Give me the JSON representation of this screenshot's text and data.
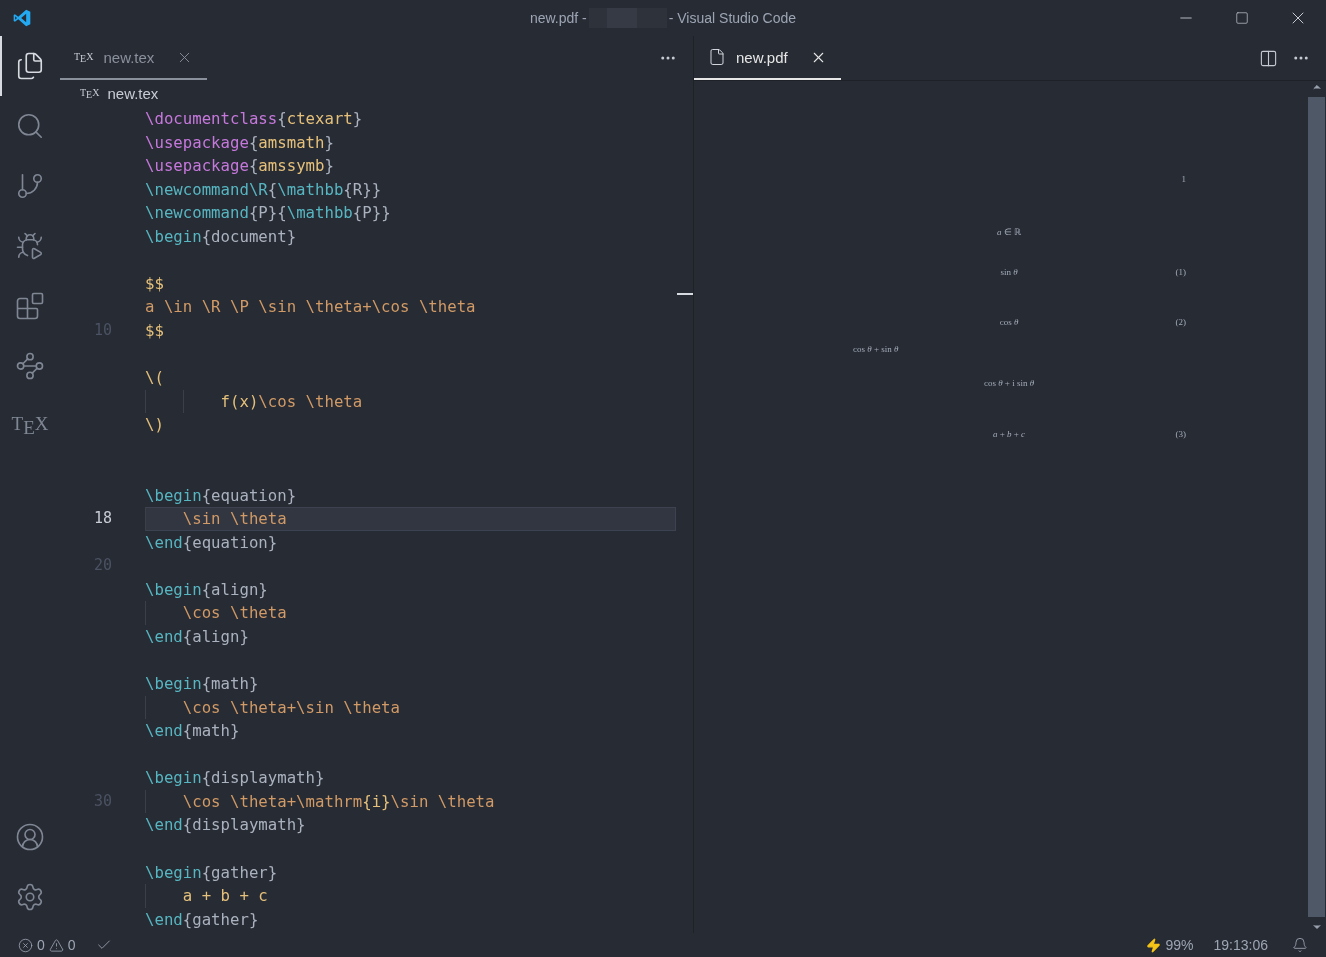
{
  "title_bar": {
    "title_start": "new.pdf -",
    "title_end": "- Visual Studio Code"
  },
  "activity_bar": {
    "top": [
      {
        "kind": "files",
        "selected": true
      },
      {
        "kind": "search",
        "selected": false
      },
      {
        "kind": "source-control",
        "selected": false
      },
      {
        "kind": "run-debug",
        "selected": false
      },
      {
        "kind": "extensions",
        "selected": false
      },
      {
        "kind": "remote",
        "selected": false
      },
      {
        "kind": "tex",
        "label": "T$_{E}$X",
        "selected": false
      }
    ],
    "bottom": [
      {
        "kind": "account"
      },
      {
        "kind": "settings"
      }
    ]
  },
  "editor": {
    "tab": {
      "icon_text": "T$_{E}$X",
      "label": "new.tex",
      "selected": true
    },
    "breadcrumb": {
      "icon_text": "T$_{E}$X",
      "label": "new.tex"
    },
    "lines": [
      {
        "current": false,
        "tokens": [
          {
            "kind": "keyword",
            "t": "\\documentclass"
          },
          {
            "kind": "brace",
            "t": "{"
          },
          {
            "kind": "arg",
            "t": "ctexart"
          },
          {
            "kind": "brace",
            "t": "}"
          }
        ]
      },
      {
        "current": false,
        "tokens": [
          {
            "kind": "keyword",
            "t": "\\usepackage"
          },
          {
            "kind": "brace",
            "t": "{"
          },
          {
            "kind": "arg",
            "t": "amsmath"
          },
          {
            "kind": "brace",
            "t": "}"
          }
        ]
      },
      {
        "current": false,
        "tokens": [
          {
            "kind": "keyword",
            "t": "\\usepackage"
          },
          {
            "kind": "brace",
            "t": "{"
          },
          {
            "kind": "arg",
            "t": "amssymb"
          },
          {
            "kind": "brace",
            "t": "}"
          }
        ]
      },
      {
        "current": false,
        "tokens": [
          {
            "kind": "command",
            "t": "\\newcommand\\R"
          },
          {
            "kind": "brace",
            "t": "{"
          },
          {
            "kind": "command",
            "t": "\\mathbb"
          },
          {
            "kind": "text",
            "t": "{R}}"
          }
        ]
      },
      {
        "current": false,
        "tokens": [
          {
            "kind": "command",
            "t": "\\newcommand"
          },
          {
            "kind": "text",
            "t": "{P}{"
          },
          {
            "kind": "command",
            "t": "\\mathbb"
          },
          {
            "kind": "text",
            "t": "{P}}"
          }
        ]
      },
      {
        "current": false,
        "tokens": [
          {
            "kind": "command",
            "t": "\\begin"
          },
          {
            "kind": "text",
            "t": "{document}"
          }
        ]
      },
      {
        "current": false
      },
      {
        "current": false,
        "tokens": [
          {
            "kind": "mathsym",
            "t": "$$"
          }
        ]
      },
      {
        "current": false,
        "tokens": [
          {
            "kind": "math",
            "t": "a \\in \\R \\P \\sin \\theta+\\cos \\theta"
          }
        ]
      },
      {
        "current": false,
        "number": "10",
        "tokens": [
          {
            "kind": "mathsym",
            "t": "$$"
          }
        ]
      },
      {
        "current": false
      },
      {
        "current": false,
        "tokens": [
          {
            "kind": "mathsym",
            "t": "\\("
          }
        ]
      },
      {
        "current": false,
        "tokens": [
          {
            "kind": "mathsym",
            "t": "        f(x)"
          },
          {
            "kind": "math",
            "t": "\\cos \\theta"
          }
        ]
      },
      {
        "current": false,
        "tokens": [
          {
            "kind": "mathsym",
            "t": "\\)"
          }
        ]
      },
      {
        "current": false
      },
      {
        "current": false
      },
      {
        "current": false,
        "tokens": [
          {
            "kind": "command",
            "t": "\\begin"
          },
          {
            "kind": "text",
            "t": "{equation}"
          }
        ]
      },
      {
        "current": true,
        "number": "18",
        "tokens": [
          {
            "kind": "math",
            "t": "    \\sin \\theta"
          }
        ]
      },
      {
        "current": false,
        "tokens": [
          {
            "kind": "command",
            "t": "\\end"
          },
          {
            "kind": "text",
            "t": "{equation}"
          }
        ]
      },
      {
        "current": false,
        "number": "20"
      },
      {
        "current": false,
        "tokens": [
          {
            "kind": "command",
            "t": "\\begin"
          },
          {
            "kind": "text",
            "t": "{align}"
          }
        ]
      },
      {
        "current": false,
        "tokens": [
          {
            "kind": "math",
            "t": "    \\cos \\theta"
          }
        ]
      },
      {
        "current": false,
        "tokens": [
          {
            "kind": "command",
            "t": "\\end"
          },
          {
            "kind": "text",
            "t": "{align}"
          }
        ]
      },
      {
        "current": false
      },
      {
        "current": false,
        "tokens": [
          {
            "kind": "command",
            "t": "\\begin"
          },
          {
            "kind": "text",
            "t": "{math}"
          }
        ]
      },
      {
        "current": false,
        "tokens": [
          {
            "kind": "math",
            "t": "    \\cos \\theta+\\sin \\theta"
          }
        ]
      },
      {
        "current": false,
        "tokens": [
          {
            "kind": "command",
            "t": "\\end"
          },
          {
            "kind": "text",
            "t": "{math}"
          }
        ]
      },
      {
        "current": false
      },
      {
        "current": false,
        "tokens": [
          {
            "kind": "command",
            "t": "\\begin"
          },
          {
            "kind": "text",
            "t": "{displaymath}"
          }
        ]
      },
      {
        "current": false,
        "number": "30",
        "tokens": [
          {
            "kind": "math",
            "t": "    \\cos \\theta+\\mathrm"
          },
          {
            "kind": "mathsym",
            "t": "{i}"
          },
          {
            "kind": "math",
            "t": "\\sin \\theta"
          }
        ]
      },
      {
        "current": false,
        "tokens": [
          {
            "kind": "command",
            "t": "\\end"
          },
          {
            "kind": "text",
            "t": "{displaymath}"
          }
        ]
      },
      {
        "current": false
      },
      {
        "current": false,
        "tokens": [
          {
            "kind": "command",
            "t": "\\begin"
          },
          {
            "kind": "text",
            "t": "{gather}"
          }
        ]
      },
      {
        "current": false,
        "tokens": [
          {
            "kind": "mathsym",
            "t": "    a + b + c"
          }
        ]
      },
      {
        "current": false,
        "tokens": [
          {
            "kind": "command",
            "t": "\\end"
          },
          {
            "kind": "text",
            "t": "{gather}"
          }
        ]
      }
    ]
  },
  "preview": {
    "tab": {
      "label": "new.pdf",
      "selected": true
    },
    "page": [
      {
        "kind": "page-number",
        "text": "1"
      },
      {
        "kind": "display",
        "text": "*a* ∈ ℝ"
      },
      {
        "kind": "numbered",
        "text": "sin *θ*",
        "tag": "(1)"
      },
      {
        "kind": "numbered",
        "text": "cos *θ*",
        "tag": "(2)"
      },
      {
        "kind": "inline",
        "text": "cos *θ* + sin *θ*"
      },
      {
        "kind": "display",
        "text": "cos *θ* + i sin *θ*"
      },
      {
        "kind": "numbered",
        "text": "*a* + *b* + *c*",
        "tag": "(3)"
      }
    ]
  },
  "status_bar": {
    "errors": "0",
    "warnings": "0",
    "battery": "99%",
    "time": "19:13:06"
  }
}
